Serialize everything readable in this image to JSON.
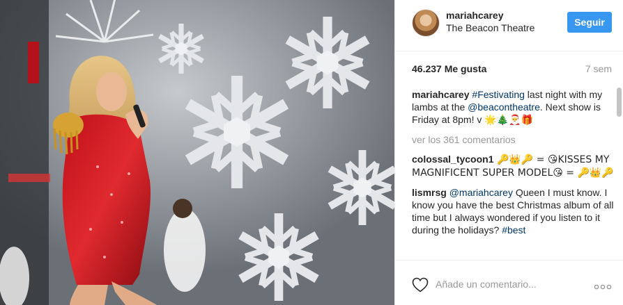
{
  "photo": {
    "alt": ""
  },
  "header": {
    "username": "mariahcarey",
    "location": "The Beacon Theatre",
    "follow_label": "Seguir"
  },
  "stats": {
    "likes": "46.237 Me gusta",
    "time": "7 sem"
  },
  "caption": {
    "user": "mariahcarey",
    "hashtag": "#Festivating",
    "text1": " last night with my lambs at the ",
    "mention": "@beacontheatre",
    "text2": ". Next show is Friday at 8pm! v ",
    "emojis": "🌟🎄🎅🎁"
  },
  "view_more": "ver los 361 comentarios",
  "comments": [
    {
      "user": "colossal_tycoon1",
      "text": " 🔑👑🔑 = 😘KISSES MY MAGNIFICENT SUPER MODEL😘 = 🔑👑🔑"
    },
    {
      "user": "lismrsg",
      "mention": "@mariahcarey",
      "text": " Queen I must know. I know you have the best Christmas album of all time but I always wondered if you listen to it during the holidays? ",
      "hashtag": "#best"
    }
  ],
  "footer": {
    "comment_placeholder": "Añade un comentario...",
    "options_icon": "ellipsis-icon",
    "like_icon": "heart-outline-icon"
  },
  "colors": {
    "follow_bg": "#3897f0",
    "link": "#003569",
    "muted": "#999999"
  }
}
